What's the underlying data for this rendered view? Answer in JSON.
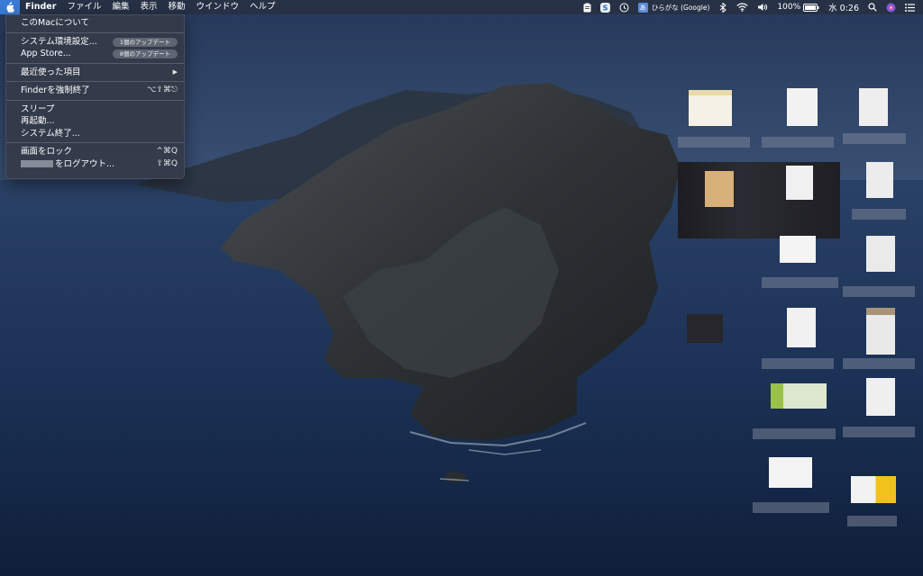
{
  "menubar": {
    "apple_icon": "apple-logo-icon",
    "app_name": "Finder",
    "menus": [
      "ファイル",
      "編集",
      "表示",
      "移動",
      "ウインドウ",
      "ヘルプ"
    ],
    "status": {
      "input_method_short": "あ",
      "input_method": "ひらがな (Google)",
      "battery": "100%",
      "clock": "水 0:26"
    }
  },
  "apple_menu": {
    "about": "このMacについて",
    "system_prefs": "システム環境設定...",
    "system_prefs_badge": "1個のアップデート",
    "app_store": "App Store...",
    "app_store_badge": "8個のアップデート",
    "recent_items": "最近使った項目",
    "recent_items_arrow": "▶",
    "force_quit": "Finderを強制終了",
    "force_quit_shortcut": "⌥⇧⌘⎋",
    "sleep": "スリープ",
    "restart": "再起動...",
    "shutdown": "システム終了...",
    "lock_screen": "画面をロック",
    "lock_screen_shortcut": "^⌘Q",
    "logout": "をログアウト...",
    "logout_shortcut": "⇧⌘Q"
  },
  "colors": {
    "menu_highlight": "#3a7bd5",
    "sea": "#1d3050",
    "menu_bg": "#343a48"
  }
}
